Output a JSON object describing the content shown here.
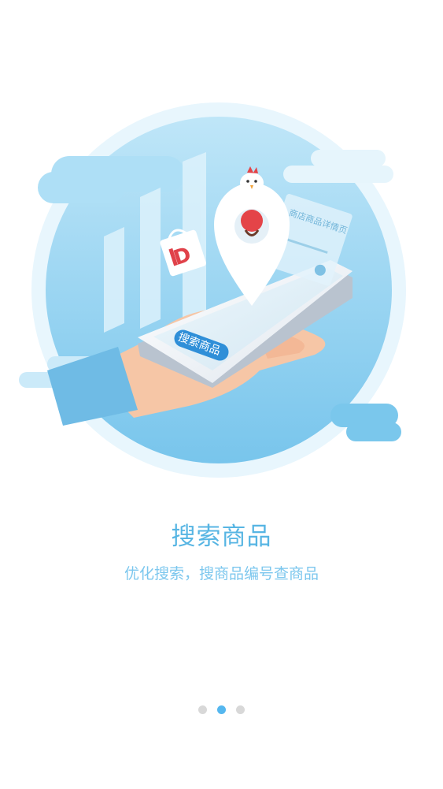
{
  "onboarding": {
    "title": "搜索商品",
    "subtitle": "优化搜索，搜商品编号查商品",
    "illustration": {
      "phone_search_label": "搜索商品",
      "info_card_label": "商店商品详情页"
    },
    "pagination": {
      "total": 3,
      "current": 2
    },
    "colors": {
      "accent": "#57b5e3",
      "subtitle": "#7cc7ee",
      "dot_inactive": "#d8d8d8",
      "dot_active": "#55b7ef"
    }
  }
}
